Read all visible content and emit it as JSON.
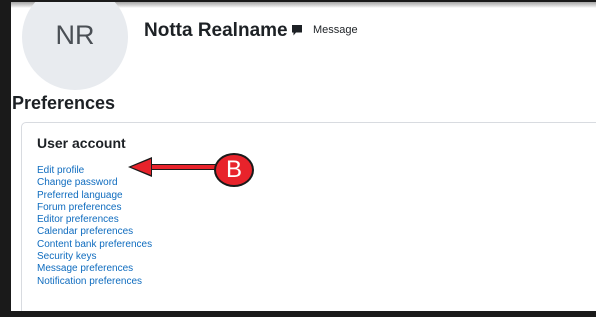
{
  "profile": {
    "initials": "NR",
    "name": "Notta Realname",
    "message_label": "Message"
  },
  "page": {
    "heading": "Preferences"
  },
  "user_account": {
    "title": "User account",
    "links": [
      "Edit profile",
      "Change password",
      "Preferred language",
      "Forum preferences",
      "Editor preferences",
      "Calendar preferences",
      "Content bank preferences",
      "Security keys",
      "Message preferences",
      "Notification preferences"
    ]
  },
  "annotation": {
    "callout_letter": "B",
    "color": "#e8232b"
  },
  "colors": {
    "link": "#0f6cbf",
    "avatar_bg": "#e8ebef",
    "text": "#1d2125"
  },
  "icons": {
    "message": "speech-bubble-icon"
  }
}
